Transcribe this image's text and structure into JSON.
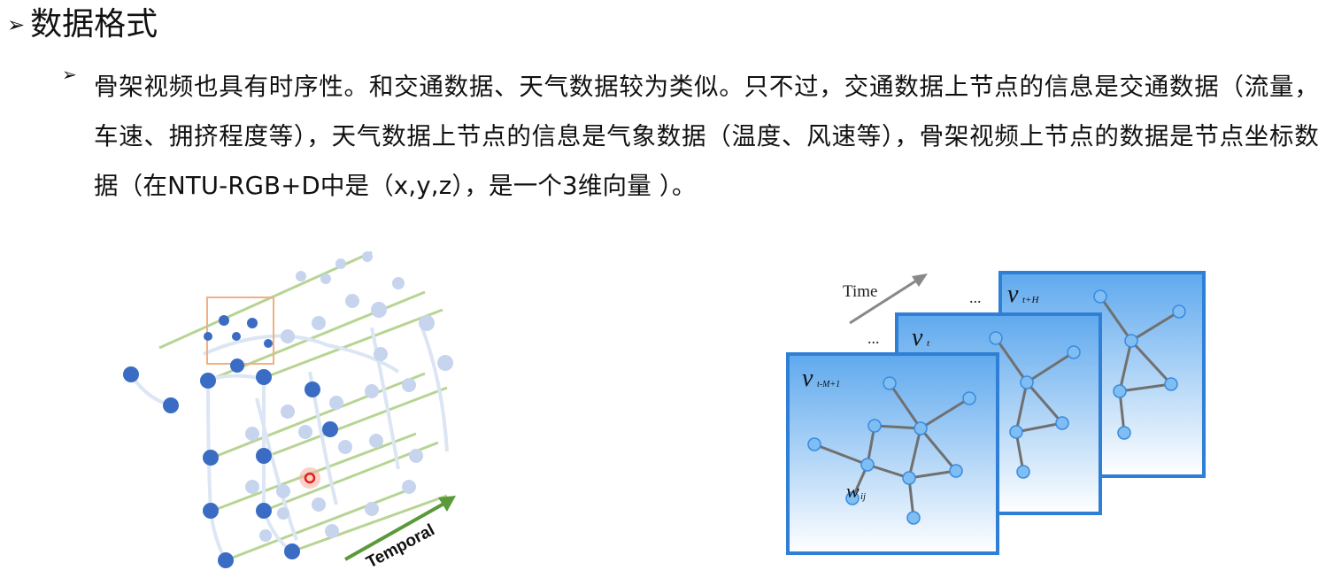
{
  "slide": {
    "title": "数据格式",
    "bullet_symbol": "➢",
    "paragraph": "骨架视频也具有时序性。和交通数据、天气数据较为类似。只不过，交通数据上节点的信息是交通数据（流量，车速、拥挤程度等），天气数据上节点的信息是气象数据（温度、风速等），骨架视频上节点的数据是节点坐标数据（在NTU-RGB+D中是（x,y,z），是一个3维向量 ）。"
  },
  "left_figure": {
    "arrow_label": "Temporal",
    "colors": {
      "joint": "#3a6cc4",
      "faded_joint": "#c8d6ee",
      "temporal_link": "#a8c880",
      "arrow": "#5a9a3a",
      "highlight": "#e04030"
    }
  },
  "right_figure": {
    "time_label": "Time",
    "ellipsis": "...",
    "frames": [
      {
        "label_main": "v",
        "label_sub": "t+H"
      },
      {
        "label_main": "v",
        "label_sub": "t"
      },
      {
        "label_main": "v",
        "label_sub": "t-M+1"
      }
    ],
    "edge_label_main": "w",
    "edge_label_sub": "ij",
    "colors": {
      "frame_border": "#2f7fd6",
      "node": "#7fbef2",
      "edge": "#707070"
    }
  }
}
